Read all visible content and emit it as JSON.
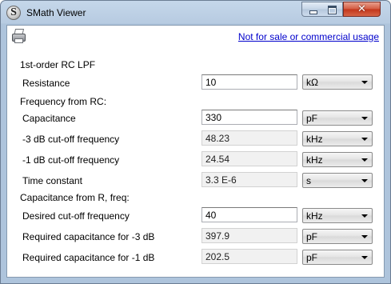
{
  "window": {
    "title": "SMath Viewer",
    "app_icon_letter": "S"
  },
  "title_buttons": {
    "close": "✕"
  },
  "toolbar": {
    "license_link": "Not for sale or commercial usage"
  },
  "sections": {
    "main": "1st-order RC LPF",
    "freq_from_rc": "Frequency from RC:",
    "cap_from_r_freq": "Capacitance from R, freq:"
  },
  "rows": [
    {
      "label": "Resistance",
      "value": "10",
      "unit": "kΩ",
      "editable": true
    },
    {
      "label": "Capacitance",
      "value": "330",
      "unit": "pF",
      "editable": true
    },
    {
      "label": "-3 dB cut-off frequency",
      "value": "48.23",
      "unit": "kHz",
      "editable": false
    },
    {
      "label": "-1 dB cut-off frequency",
      "value": "24.54",
      "unit": "kHz",
      "editable": false
    },
    {
      "label": "Time constant",
      "value": "3.3 E-6",
      "unit": "s",
      "editable": false
    },
    {
      "label": "Desired cut-off frequency",
      "value": "40",
      "unit": "kHz",
      "editable": true
    },
    {
      "label": "Required capacitance for -3 dB",
      "value": "397.9",
      "unit": "pF",
      "editable": false
    },
    {
      "label": "Required capacitance for -1 dB",
      "value": "202.5",
      "unit": "pF",
      "editable": false
    }
  ]
}
